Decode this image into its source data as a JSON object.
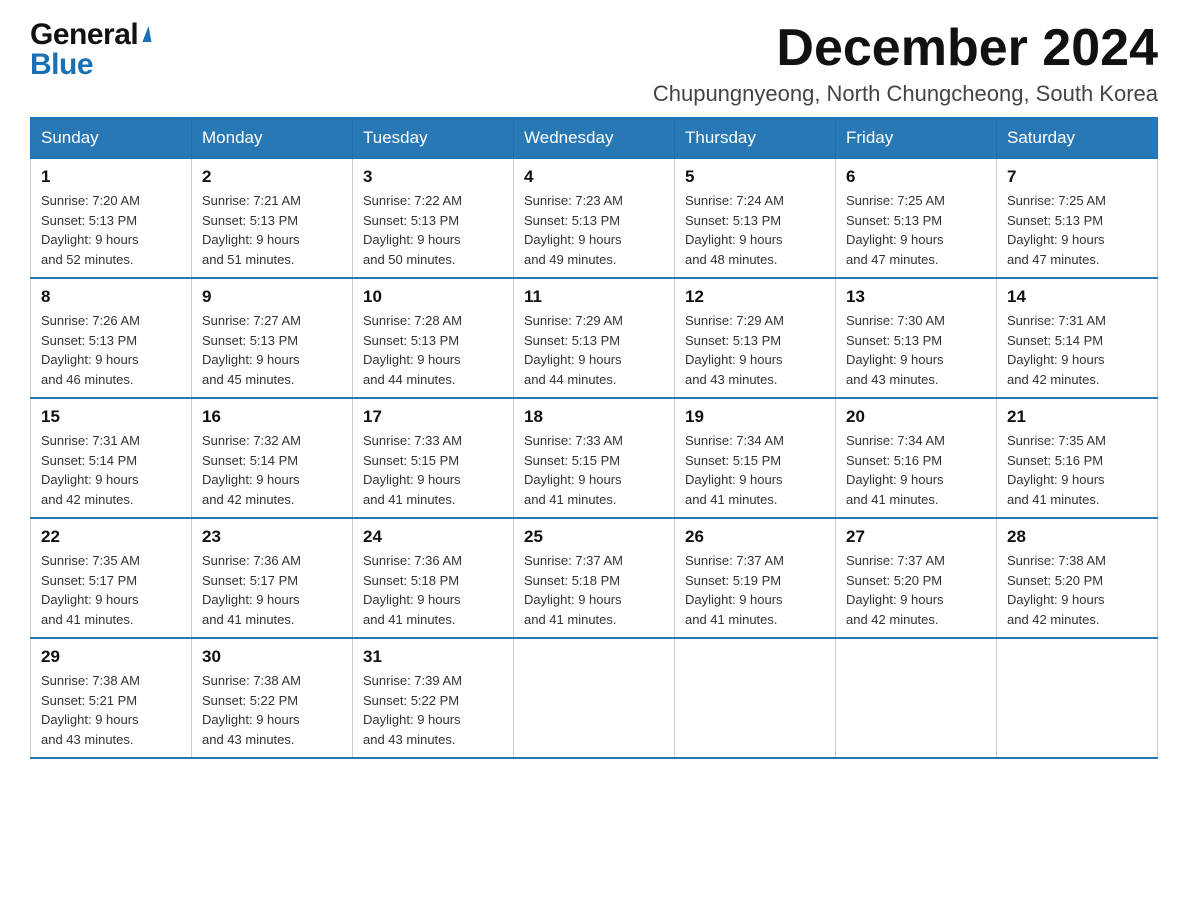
{
  "logo": {
    "general": "General",
    "blue": "Blue"
  },
  "header": {
    "month_year": "December 2024",
    "location": "Chupungnyeong, North Chungcheong, South Korea"
  },
  "days_of_week": [
    "Sunday",
    "Monday",
    "Tuesday",
    "Wednesday",
    "Thursday",
    "Friday",
    "Saturday"
  ],
  "weeks": [
    [
      {
        "day": "1",
        "sunrise": "Sunrise: 7:20 AM",
        "sunset": "Sunset: 5:13 PM",
        "daylight": "Daylight: 9 hours",
        "daylight2": "and 52 minutes."
      },
      {
        "day": "2",
        "sunrise": "Sunrise: 7:21 AM",
        "sunset": "Sunset: 5:13 PM",
        "daylight": "Daylight: 9 hours",
        "daylight2": "and 51 minutes."
      },
      {
        "day": "3",
        "sunrise": "Sunrise: 7:22 AM",
        "sunset": "Sunset: 5:13 PM",
        "daylight": "Daylight: 9 hours",
        "daylight2": "and 50 minutes."
      },
      {
        "day": "4",
        "sunrise": "Sunrise: 7:23 AM",
        "sunset": "Sunset: 5:13 PM",
        "daylight": "Daylight: 9 hours",
        "daylight2": "and 49 minutes."
      },
      {
        "day": "5",
        "sunrise": "Sunrise: 7:24 AM",
        "sunset": "Sunset: 5:13 PM",
        "daylight": "Daylight: 9 hours",
        "daylight2": "and 48 minutes."
      },
      {
        "day": "6",
        "sunrise": "Sunrise: 7:25 AM",
        "sunset": "Sunset: 5:13 PM",
        "daylight": "Daylight: 9 hours",
        "daylight2": "and 47 minutes."
      },
      {
        "day": "7",
        "sunrise": "Sunrise: 7:25 AM",
        "sunset": "Sunset: 5:13 PM",
        "daylight": "Daylight: 9 hours",
        "daylight2": "and 47 minutes."
      }
    ],
    [
      {
        "day": "8",
        "sunrise": "Sunrise: 7:26 AM",
        "sunset": "Sunset: 5:13 PM",
        "daylight": "Daylight: 9 hours",
        "daylight2": "and 46 minutes."
      },
      {
        "day": "9",
        "sunrise": "Sunrise: 7:27 AM",
        "sunset": "Sunset: 5:13 PM",
        "daylight": "Daylight: 9 hours",
        "daylight2": "and 45 minutes."
      },
      {
        "day": "10",
        "sunrise": "Sunrise: 7:28 AM",
        "sunset": "Sunset: 5:13 PM",
        "daylight": "Daylight: 9 hours",
        "daylight2": "and 44 minutes."
      },
      {
        "day": "11",
        "sunrise": "Sunrise: 7:29 AM",
        "sunset": "Sunset: 5:13 PM",
        "daylight": "Daylight: 9 hours",
        "daylight2": "and 44 minutes."
      },
      {
        "day": "12",
        "sunrise": "Sunrise: 7:29 AM",
        "sunset": "Sunset: 5:13 PM",
        "daylight": "Daylight: 9 hours",
        "daylight2": "and 43 minutes."
      },
      {
        "day": "13",
        "sunrise": "Sunrise: 7:30 AM",
        "sunset": "Sunset: 5:13 PM",
        "daylight": "Daylight: 9 hours",
        "daylight2": "and 43 minutes."
      },
      {
        "day": "14",
        "sunrise": "Sunrise: 7:31 AM",
        "sunset": "Sunset: 5:14 PM",
        "daylight": "Daylight: 9 hours",
        "daylight2": "and 42 minutes."
      }
    ],
    [
      {
        "day": "15",
        "sunrise": "Sunrise: 7:31 AM",
        "sunset": "Sunset: 5:14 PM",
        "daylight": "Daylight: 9 hours",
        "daylight2": "and 42 minutes."
      },
      {
        "day": "16",
        "sunrise": "Sunrise: 7:32 AM",
        "sunset": "Sunset: 5:14 PM",
        "daylight": "Daylight: 9 hours",
        "daylight2": "and 42 minutes."
      },
      {
        "day": "17",
        "sunrise": "Sunrise: 7:33 AM",
        "sunset": "Sunset: 5:15 PM",
        "daylight": "Daylight: 9 hours",
        "daylight2": "and 41 minutes."
      },
      {
        "day": "18",
        "sunrise": "Sunrise: 7:33 AM",
        "sunset": "Sunset: 5:15 PM",
        "daylight": "Daylight: 9 hours",
        "daylight2": "and 41 minutes."
      },
      {
        "day": "19",
        "sunrise": "Sunrise: 7:34 AM",
        "sunset": "Sunset: 5:15 PM",
        "daylight": "Daylight: 9 hours",
        "daylight2": "and 41 minutes."
      },
      {
        "day": "20",
        "sunrise": "Sunrise: 7:34 AM",
        "sunset": "Sunset: 5:16 PM",
        "daylight": "Daylight: 9 hours",
        "daylight2": "and 41 minutes."
      },
      {
        "day": "21",
        "sunrise": "Sunrise: 7:35 AM",
        "sunset": "Sunset: 5:16 PM",
        "daylight": "Daylight: 9 hours",
        "daylight2": "and 41 minutes."
      }
    ],
    [
      {
        "day": "22",
        "sunrise": "Sunrise: 7:35 AM",
        "sunset": "Sunset: 5:17 PM",
        "daylight": "Daylight: 9 hours",
        "daylight2": "and 41 minutes."
      },
      {
        "day": "23",
        "sunrise": "Sunrise: 7:36 AM",
        "sunset": "Sunset: 5:17 PM",
        "daylight": "Daylight: 9 hours",
        "daylight2": "and 41 minutes."
      },
      {
        "day": "24",
        "sunrise": "Sunrise: 7:36 AM",
        "sunset": "Sunset: 5:18 PM",
        "daylight": "Daylight: 9 hours",
        "daylight2": "and 41 minutes."
      },
      {
        "day": "25",
        "sunrise": "Sunrise: 7:37 AM",
        "sunset": "Sunset: 5:18 PM",
        "daylight": "Daylight: 9 hours",
        "daylight2": "and 41 minutes."
      },
      {
        "day": "26",
        "sunrise": "Sunrise: 7:37 AM",
        "sunset": "Sunset: 5:19 PM",
        "daylight": "Daylight: 9 hours",
        "daylight2": "and 41 minutes."
      },
      {
        "day": "27",
        "sunrise": "Sunrise: 7:37 AM",
        "sunset": "Sunset: 5:20 PM",
        "daylight": "Daylight: 9 hours",
        "daylight2": "and 42 minutes."
      },
      {
        "day": "28",
        "sunrise": "Sunrise: 7:38 AM",
        "sunset": "Sunset: 5:20 PM",
        "daylight": "Daylight: 9 hours",
        "daylight2": "and 42 minutes."
      }
    ],
    [
      {
        "day": "29",
        "sunrise": "Sunrise: 7:38 AM",
        "sunset": "Sunset: 5:21 PM",
        "daylight": "Daylight: 9 hours",
        "daylight2": "and 43 minutes."
      },
      {
        "day": "30",
        "sunrise": "Sunrise: 7:38 AM",
        "sunset": "Sunset: 5:22 PM",
        "daylight": "Daylight: 9 hours",
        "daylight2": "and 43 minutes."
      },
      {
        "day": "31",
        "sunrise": "Sunrise: 7:39 AM",
        "sunset": "Sunset: 5:22 PM",
        "daylight": "Daylight: 9 hours",
        "daylight2": "and 43 minutes."
      },
      null,
      null,
      null,
      null
    ]
  ]
}
